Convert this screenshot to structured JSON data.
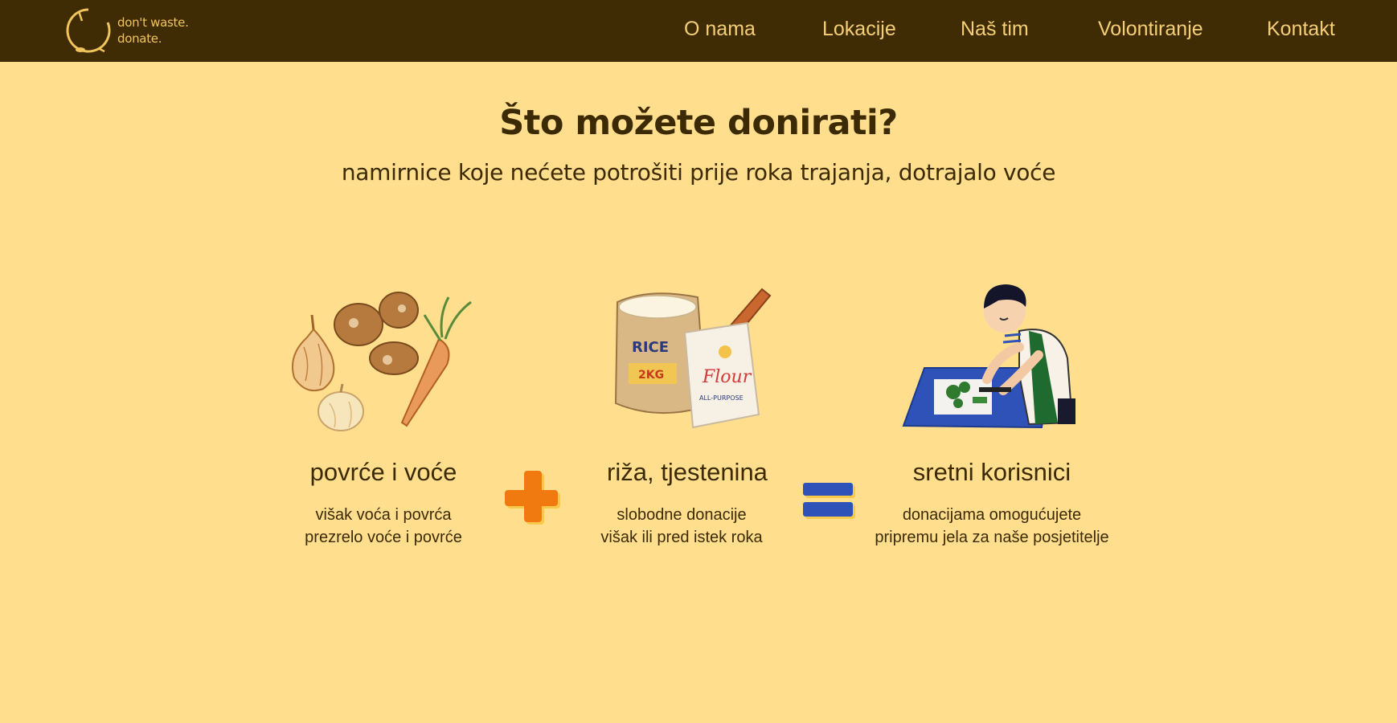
{
  "logo": {
    "line1": "don't waste.",
    "line2": "donate."
  },
  "nav": [
    "O nama",
    "Lokacije",
    "Naš tim",
    "Volontiranje",
    "Kontakt"
  ],
  "hero": {
    "title": "Što možete donirati?",
    "subtitle": "namirnice koje nećete potrošiti prije roka trajanja, dotrajalo voće"
  },
  "cards": [
    {
      "title": "povrće i voće",
      "lines": [
        "višak voća i povrća",
        "prezrelo voće i povrće"
      ],
      "illustration": "vegetables-illustration"
    },
    {
      "title": "riža, tjestenina",
      "lines": [
        "slobodne donacije",
        "višak ili pred istek roka"
      ],
      "illustration": "rice-flour-illustration",
      "label_rice": "RICE",
      "label_weight": "2KG",
      "label_flour": "Flour",
      "label_purpose": "ALL-PURPOSE"
    },
    {
      "title": "sretni korisnici",
      "lines": [
        "donacijama omogućujete",
        "pripremu jela za naše posjetitelje"
      ],
      "illustration": "chef-illustration"
    }
  ],
  "operators": {
    "plus": "plus-icon",
    "equals": "equals-icon"
  },
  "colors": {
    "nav_bg": "#402c04",
    "page_bg": "#ffdf8e",
    "nav_text": "#f5cf78",
    "accent_orange": "#f07a10",
    "accent_blue": "#2f52b8"
  }
}
